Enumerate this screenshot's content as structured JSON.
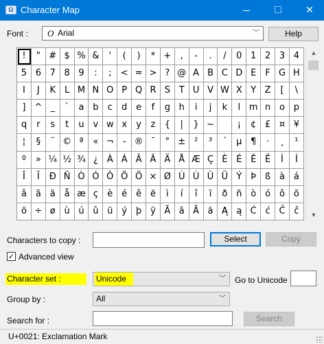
{
  "window": {
    "title": "Character Map",
    "icon": "charmap-app-icon"
  },
  "font": {
    "label": "Font :",
    "value": "Arial",
    "glyph": "O",
    "help_label": "Help"
  },
  "grid": {
    "selected_index": 0,
    "cells": [
      "!",
      "\"",
      "#",
      "$",
      "%",
      "&",
      "'",
      "(",
      ")",
      "*",
      "+",
      ",",
      "-",
      ".",
      "/",
      "0",
      "1",
      "2",
      "3",
      "4",
      "5",
      "6",
      "7",
      "8",
      "9",
      ":",
      ";",
      "<",
      "=",
      ">",
      "?",
      "@",
      "A",
      "B",
      "C",
      "D",
      "E",
      "F",
      "G",
      "H",
      "I",
      "J",
      "K",
      "L",
      "M",
      "N",
      "O",
      "P",
      "Q",
      "R",
      "S",
      "T",
      "U",
      "V",
      "W",
      "X",
      "Y",
      "Z",
      "[",
      "\\",
      "]",
      "^",
      "_",
      "`",
      "a",
      "b",
      "c",
      "d",
      "e",
      "f",
      "g",
      "h",
      "i",
      "j",
      "k",
      "l",
      "m",
      "n",
      "o",
      "p",
      "q",
      "r",
      "s",
      "t",
      "u",
      "v",
      "w",
      "x",
      "y",
      "z",
      "{",
      "|",
      "}",
      "~",
      " ",
      "¡",
      "¢",
      "£",
      "¤",
      "¥",
      "¦",
      "§",
      "¨",
      "©",
      "ª",
      "«",
      "¬",
      "-",
      "®",
      "¯",
      "°",
      "±",
      "²",
      "³",
      "´",
      "µ",
      "¶",
      "·",
      "¸",
      "¹",
      "º",
      "»",
      "¼",
      "½",
      "¾",
      "¿",
      "À",
      "Á",
      "Â",
      "Ã",
      "Ä",
      "Å",
      "Æ",
      "Ç",
      "È",
      "É",
      "Ê",
      "Ë",
      "Ì",
      "Í",
      "Î",
      "Ï",
      "Ð",
      "Ñ",
      "Ò",
      "Ó",
      "Ô",
      "Õ",
      "Ö",
      "×",
      "Ø",
      "Ù",
      "Ú",
      "Û",
      "Ü",
      "Ý",
      "Þ",
      "ß",
      "à",
      "á",
      "â",
      "ã",
      "ä",
      "å",
      "æ",
      "ç",
      "è",
      "é",
      "ê",
      "ë",
      "ì",
      "í",
      "î",
      "ï",
      "ð",
      "ñ",
      "ò",
      "ó",
      "ô",
      "õ",
      "ö",
      "÷",
      "ø",
      "ù",
      "ú",
      "û",
      "ü",
      "ý",
      "þ",
      "ÿ",
      "Ā",
      "ā",
      "Ă",
      "ă",
      "Ą",
      "ą",
      "Ć",
      "ć",
      "Ĉ",
      "ĉ"
    ]
  },
  "copy": {
    "label": "Characters to copy :",
    "value": "",
    "select_label": "Select",
    "copy_label": "Copy"
  },
  "advanced": {
    "label": "Advanced view",
    "checked": true
  },
  "charset": {
    "label": "Character set :",
    "value": "Unicode",
    "goto_label": "Go to Unicode :",
    "goto_value": ""
  },
  "groupby": {
    "label": "Group by :",
    "value": "All"
  },
  "search": {
    "label": "Search for :",
    "value": "",
    "button_label": "Search"
  },
  "status": {
    "text": "U+0021: Exclamation Mark"
  },
  "colors": {
    "titlebar": "#0078d7",
    "highlight": "#ffff00",
    "window_bg": "#f0f0f0"
  }
}
